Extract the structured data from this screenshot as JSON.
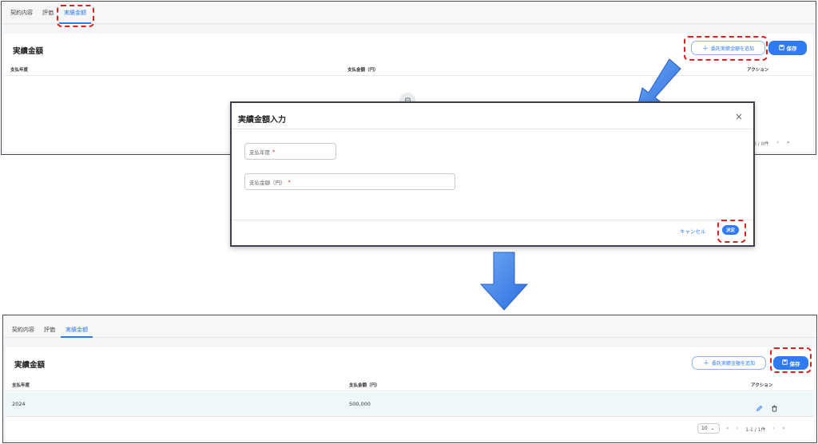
{
  "top_screen": {
    "tabs": [
      {
        "label": "契約内容"
      },
      {
        "label": "評価"
      },
      {
        "label": "実績金額"
      }
    ],
    "section_title": "実績金額",
    "add_button_label": "委託実績金額を追加",
    "save_button_label": "保存",
    "columns": [
      "支払年度",
      "支払金額（円）",
      "アクション"
    ],
    "pagination_text": "0 / 0件"
  },
  "dialog": {
    "title": "実績金額入力",
    "field_year_label": "支払年度",
    "field_amount_label": "支払金額（円）",
    "required_mark": "*",
    "cancel_label": "キャンセル",
    "confirm_label": "決定"
  },
  "bottom_screen": {
    "tabs": [
      {
        "label": "契約内容"
      },
      {
        "label": "評価"
      },
      {
        "label": "実績金額"
      }
    ],
    "section_title": "実績金額",
    "add_button_label": "委託実績金額を追加",
    "save_button_label": "保存",
    "columns": [
      "支払年度",
      "支払金額（円）",
      "アクション"
    ],
    "rows": [
      {
        "year": "2024",
        "amount": "500,000"
      }
    ],
    "page_size": "10",
    "pagination_text": "1-1 / 1件"
  },
  "colors": {
    "accent": "#2f7bf5",
    "highlight_dash": "#e02020",
    "row_highlight": "#eef8fa",
    "arrow": "#3d86f0"
  }
}
